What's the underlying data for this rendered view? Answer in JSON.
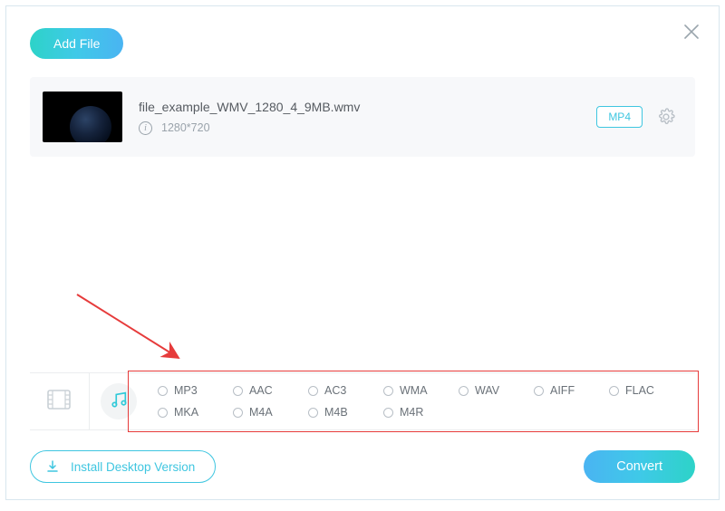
{
  "buttons": {
    "add_file": "Add File",
    "install_desktop": "Install Desktop Version",
    "convert": "Convert"
  },
  "file": {
    "name": "file_example_WMV_1280_4_9MB.wmv",
    "resolution": "1280*720",
    "output_format": "MP4"
  },
  "format_tabs": {
    "active": "audio"
  },
  "audio_formats_row1": [
    {
      "label": "MP3"
    },
    {
      "label": "AAC"
    },
    {
      "label": "AC3"
    },
    {
      "label": "WMA"
    },
    {
      "label": "WAV"
    },
    {
      "label": "AIFF"
    },
    {
      "label": "FLAC"
    }
  ],
  "audio_formats_row2": [
    {
      "label": "MKA"
    },
    {
      "label": "M4A"
    },
    {
      "label": "M4B"
    },
    {
      "label": "M4R"
    }
  ]
}
